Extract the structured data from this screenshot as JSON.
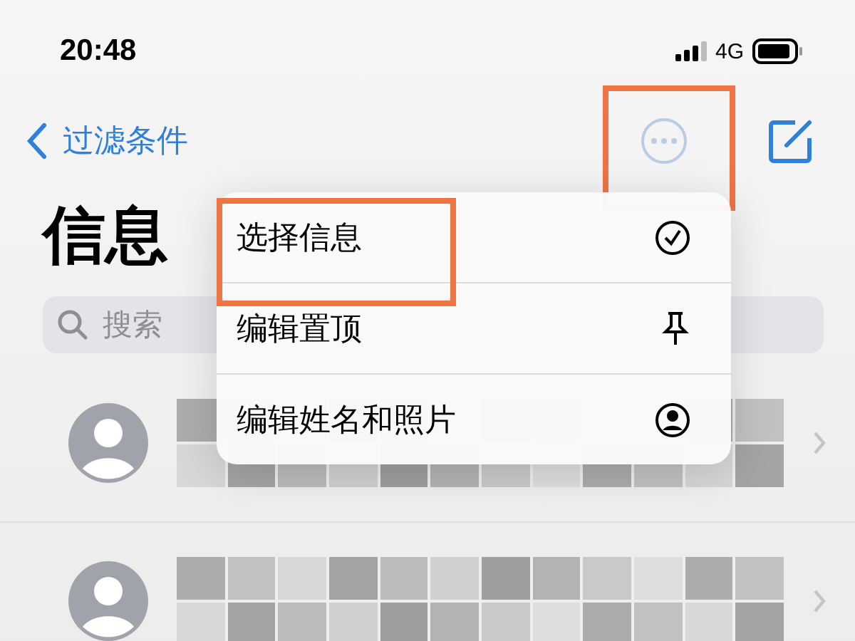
{
  "status_bar": {
    "time": "20:48",
    "network": "4G"
  },
  "nav": {
    "back_label": "过滤条件",
    "more_highlighted": true
  },
  "title": "信息",
  "search": {
    "placeholder": "搜索"
  },
  "menu": [
    {
      "label": "选择信息",
      "kind": "select",
      "highlighted": true
    },
    {
      "label": "编辑置顶",
      "kind": "pin",
      "highlighted": false
    },
    {
      "label": "编辑姓名和照片",
      "kind": "contact",
      "highlighted": false
    }
  ],
  "conversations": [
    {
      "kind": "redacted"
    },
    {
      "kind": "redacted"
    }
  ]
}
